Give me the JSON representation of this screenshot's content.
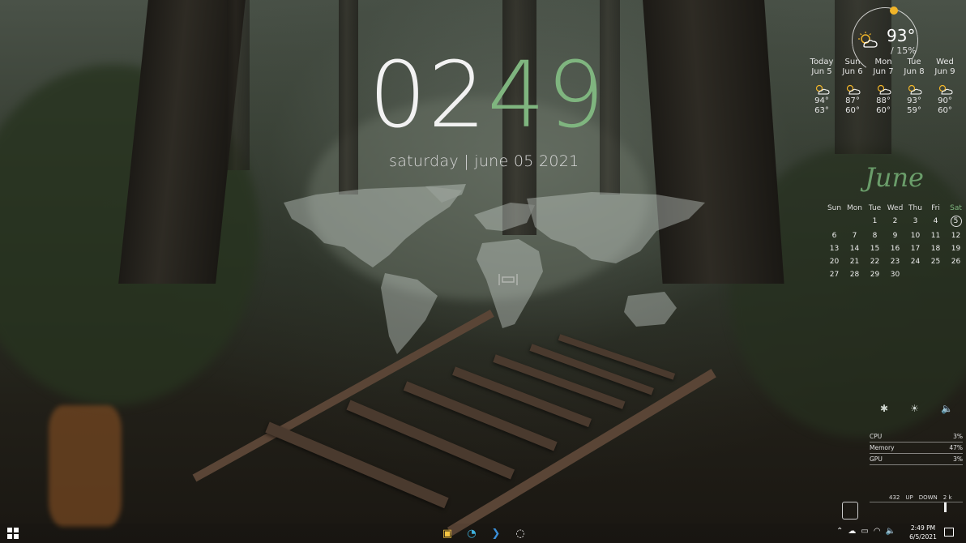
{
  "clock": {
    "hours": "02",
    "minutes": "49"
  },
  "date": {
    "line": "saturday  |  june 05 2021"
  },
  "weather": {
    "current_temp": "93°",
    "current_pct": "15%",
    "days": [
      {
        "name": "Today",
        "date": "Jun 5",
        "high": "94°",
        "low": "63°"
      },
      {
        "name": "Sun",
        "date": "Jun 6",
        "high": "87°",
        "low": "60°"
      },
      {
        "name": "Mon",
        "date": "Jun 7",
        "high": "88°",
        "low": "60°"
      },
      {
        "name": "Tue",
        "date": "Jun 8",
        "high": "93°",
        "low": "59°"
      },
      {
        "name": "Wed",
        "date": "Jun 9",
        "high": "90°",
        "low": "60°"
      }
    ]
  },
  "calendar": {
    "month": "June",
    "weekdays": [
      "Sun",
      "Mon",
      "Tue",
      "Wed",
      "Thu",
      "Fri",
      "Sat"
    ],
    "weeks": [
      [
        "",
        "",
        "1",
        "2",
        "3",
        "4",
        "5"
      ],
      [
        "6",
        "7",
        "8",
        "9",
        "10",
        "11",
        "12"
      ],
      [
        "13",
        "14",
        "15",
        "16",
        "17",
        "18",
        "19"
      ],
      [
        "20",
        "21",
        "22",
        "23",
        "24",
        "25",
        "26"
      ],
      [
        "27",
        "28",
        "29",
        "30",
        "",
        "",
        ""
      ]
    ],
    "today": "5"
  },
  "system": {
    "cpu_label": "CPU",
    "cpu_value": "3%",
    "memory_label": "Memory",
    "memory_value": "47%",
    "gpu_label": "GPU",
    "gpu_value": "3%",
    "net_up": "432",
    "net_up_label": "UP",
    "net_down_label": "DOWN",
    "net_down": "2 k"
  },
  "taskbar": {
    "time": "2:49 PM",
    "date": "6/5/2021",
    "apps": [
      "file-explorer-icon",
      "edge-icon",
      "vscode-icon",
      "steelseries-icon"
    ]
  },
  "colors": {
    "accent_green": "#7fb57f",
    "sun_dot": "#f0b429"
  }
}
